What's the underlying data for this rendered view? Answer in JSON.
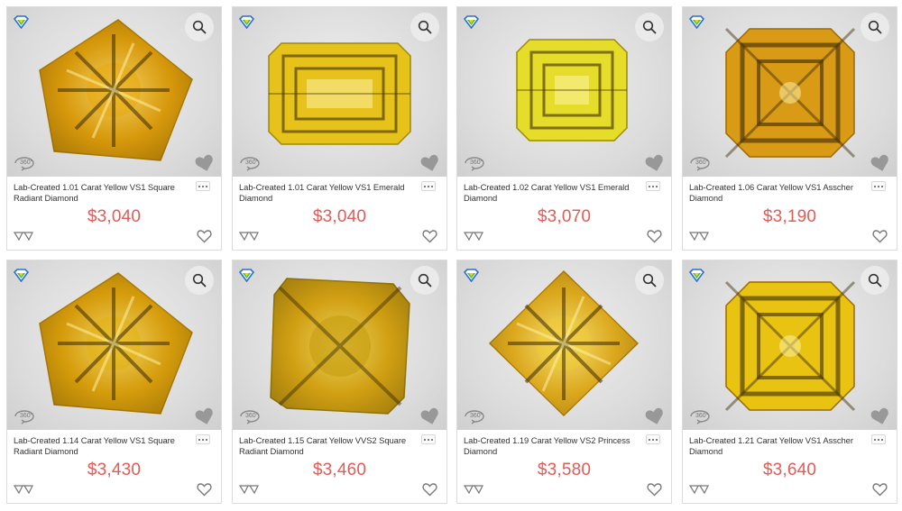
{
  "colors": {
    "price": "#e45a55",
    "card_border": "#dcdcdc",
    "photo_bg": "#dcdcdc"
  },
  "icons": {
    "brand": "diamond-logo-icon",
    "zoom": "magnifier-icon",
    "spin": "360-view-icon",
    "favorite_overlay": "heart-shape-icon",
    "compare": "compare-icon",
    "wishlist": "heart-outline-icon",
    "more": "more-options-icon"
  },
  "spin_label": "360°",
  "products": [
    {
      "title": "Lab-Created 1.01 Carat Yellow VS1 Square Radiant Diamond",
      "price": "$3,040",
      "shape": "radiant-tilted",
      "tone": "#e7a911"
    },
    {
      "title": "Lab-Created 1.01 Carat Yellow VS1 Emerald Diamond",
      "price": "$3,040",
      "shape": "emerald",
      "tone": "#e6c21a"
    },
    {
      "title": "Lab-Created 1.02 Carat Yellow VS1 Emerald Diamond",
      "price": "$3,070",
      "shape": "emerald-small",
      "tone": "#e6dc2a"
    },
    {
      "title": "Lab-Created 1.06 Carat Yellow VS1 Asscher Diamond",
      "price": "$3,190",
      "shape": "asscher",
      "tone": "#d99a16"
    },
    {
      "title": "Lab-Created 1.14 Carat Yellow VS1 Square Radiant Diamond",
      "price": "$3,430",
      "shape": "radiant-tilted",
      "tone": "#e3b012"
    },
    {
      "title": "Lab-Created 1.15 Carat Yellow VVS2 Square Radiant Diamond",
      "price": "$3,460",
      "shape": "radiant-square",
      "tone": "#d8b41e"
    },
    {
      "title": "Lab-Created 1.19 Carat Yellow VS2 Princess Diamond",
      "price": "$3,580",
      "shape": "princess",
      "tone": "#efc935"
    },
    {
      "title": "Lab-Created 1.21 Carat Yellow VS1 Asscher Diamond",
      "price": "$3,640",
      "shape": "asscher",
      "tone": "#e8c312"
    }
  ]
}
